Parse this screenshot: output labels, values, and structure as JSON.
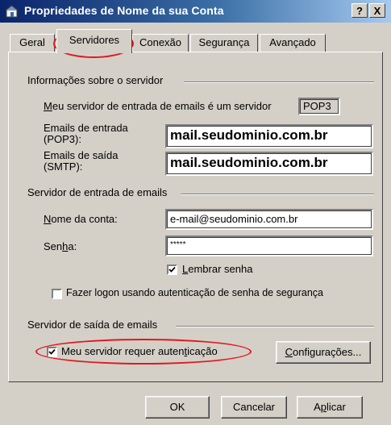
{
  "window": {
    "title": "Propriedades de Nome da sua Conta",
    "help_button": "?",
    "close_button": "X"
  },
  "tabs": [
    {
      "label": "Geral"
    },
    {
      "label": "Servidores"
    },
    {
      "label": "Conexão"
    },
    {
      "label": "Segurança"
    },
    {
      "label": "Avançado"
    }
  ],
  "server_info": {
    "title": "Informações sobre o servidor",
    "incoming_type_label": "Meu servidor de entrada de emails é um servidor",
    "incoming_type_value": "POP3",
    "incoming_label_line1": "Emails de entrada",
    "incoming_label_line2": "(POP3):",
    "incoming_value": "mail.seudominio.com.br",
    "outgoing_label_line1": "Emails de saída",
    "outgoing_label_line2": "(SMTP):",
    "outgoing_value": "mail.seudominio.com.br"
  },
  "incoming_server": {
    "title": "Servidor de entrada de emails",
    "account_label": "Nome da conta:",
    "account_value": "e-mail@seudominio.com.br",
    "password_label": "Senha:",
    "password_value": "*****",
    "remember_password_label": "Lembrar senha",
    "remember_password_checked": true,
    "secure_auth_label": "Fazer logon usando autenticação de senha de segurança",
    "secure_auth_checked": false
  },
  "outgoing_server": {
    "title": "Servidor de saída de emails",
    "requires_auth_label": "Meu servidor requer autenticação",
    "requires_auth_checked": true,
    "settings_button": "Configurações..."
  },
  "footer": {
    "ok": "OK",
    "cancel": "Cancelar",
    "apply": "Aplicar"
  },
  "colors": {
    "highlight_oval": "#e0191c",
    "title_bar_start": "#0a246a",
    "title_bar_end": "#a6caf0"
  }
}
